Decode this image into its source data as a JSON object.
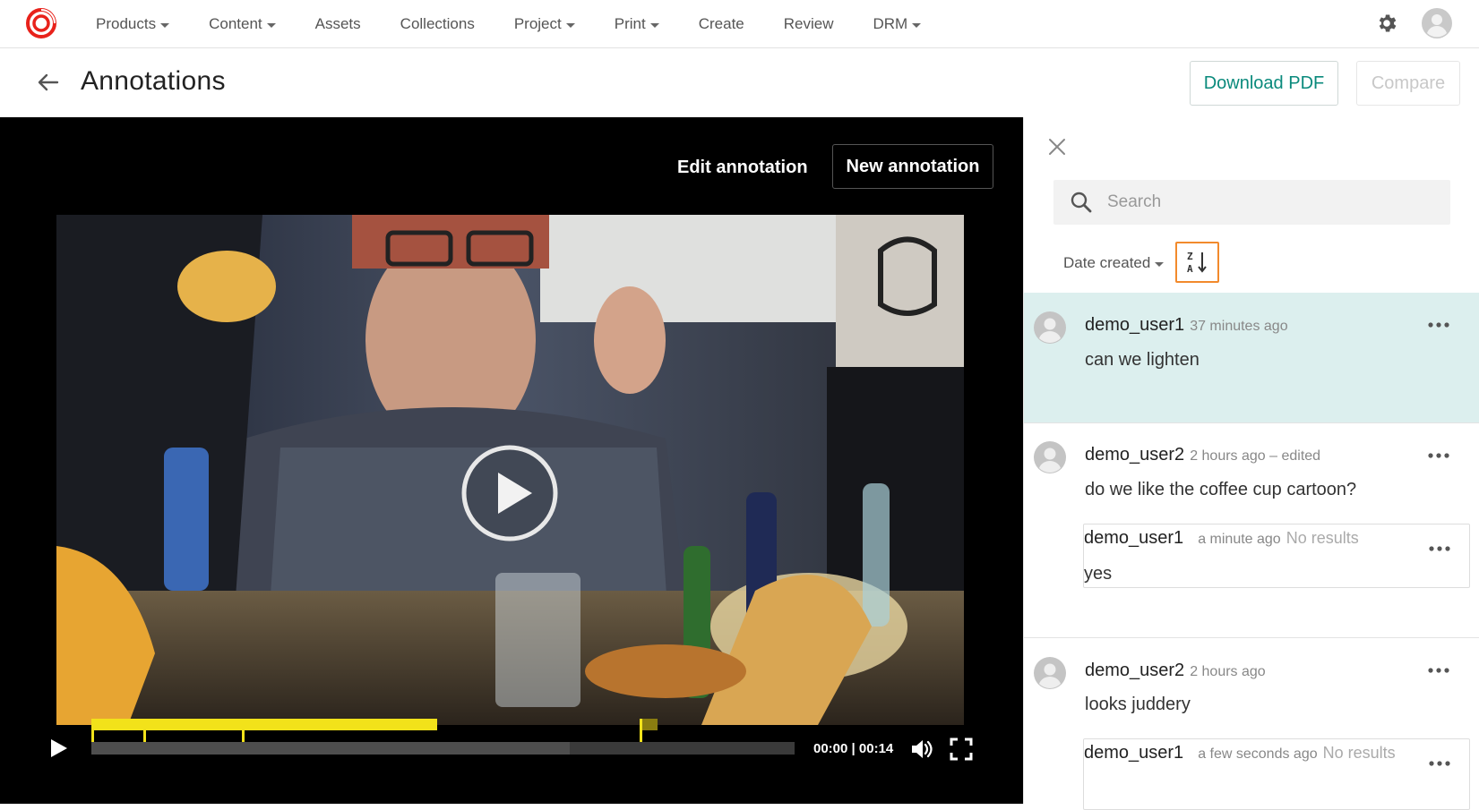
{
  "nav": {
    "items": [
      {
        "label": "Products",
        "dropdown": true
      },
      {
        "label": "Content",
        "dropdown": true
      },
      {
        "label": "Assets",
        "dropdown": false
      },
      {
        "label": "Collections",
        "dropdown": false
      },
      {
        "label": "Project",
        "dropdown": true
      },
      {
        "label": "Print",
        "dropdown": true
      },
      {
        "label": "Create",
        "dropdown": false
      },
      {
        "label": "Review",
        "dropdown": false
      },
      {
        "label": "DRM",
        "dropdown": true
      }
    ],
    "logo_icon": "brand-logo-icon",
    "settings_icon": "gear-icon",
    "user_icon": "user-avatar-icon",
    "brand_color": "#e8221b"
  },
  "header": {
    "title": "Annotations",
    "download_label": "Download PDF",
    "compare_label": "Compare",
    "accent_color": "#0a8a7c"
  },
  "player": {
    "edit_label": "Edit annotation",
    "new_label": "New annotation",
    "current_time": "00:00",
    "duration": "00:14",
    "time_display": "00:00 | 00:14",
    "buffered_fraction": 0.68,
    "annotation_color": "#f2e21a"
  },
  "panel": {
    "search_placeholder": "Search",
    "sort_label": "Date created",
    "sort_icon": "sort-z-a-icon",
    "sort_highlight_color": "#f28a2c",
    "comments": [
      {
        "user": "demo_user1",
        "time": "37 minutes ago",
        "text": "can we lighten",
        "active": true,
        "replies": []
      },
      {
        "user": "demo_user2",
        "time": "2 hours ago – edited",
        "text": "do we like the coffee cup cartoon?",
        "active": false,
        "replies": [
          {
            "user": "demo_user1",
            "time": "a minute ago",
            "status": "No results",
            "text": "yes"
          }
        ]
      },
      {
        "user": "demo_user2",
        "time": "2 hours ago",
        "text": "looks juddery",
        "active": false,
        "replies": [
          {
            "user": "demo_user1",
            "time": "a few seconds ago",
            "status": "No results",
            "text": ""
          }
        ]
      }
    ]
  }
}
